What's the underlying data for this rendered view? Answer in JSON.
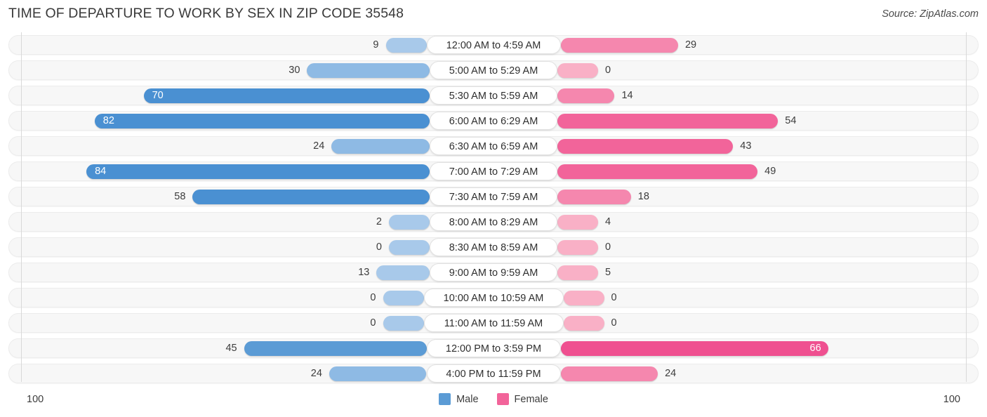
{
  "header": {
    "title": "TIME OF DEPARTURE TO WORK BY SEX IN ZIP CODE 35548",
    "source": "Source: ZipAtlas.com"
  },
  "legend": {
    "male_label": "Male",
    "female_label": "Female",
    "male_color": "#5b9bd5",
    "female_color": "#f2649a"
  },
  "axis": {
    "left_end": "100",
    "right_end": "100"
  },
  "chart_data": {
    "type": "bar",
    "orientation": "horizontal",
    "style": "diverging-bidirectional",
    "title": "TIME OF DEPARTURE TO WORK BY SEX IN ZIP CODE 35548",
    "xlabel": "",
    "ylabel": "",
    "xlim": [
      0,
      100
    ],
    "grid": false,
    "legend_position": "bottom-center",
    "categories": [
      "12:00 AM to 4:59 AM",
      "5:00 AM to 5:29 AM",
      "5:30 AM to 5:59 AM",
      "6:00 AM to 6:29 AM",
      "6:30 AM to 6:59 AM",
      "7:00 AM to 7:29 AM",
      "7:30 AM to 7:59 AM",
      "8:00 AM to 8:29 AM",
      "8:30 AM to 8:59 AM",
      "9:00 AM to 9:59 AM",
      "10:00 AM to 10:59 AM",
      "11:00 AM to 11:59 AM",
      "12:00 PM to 3:59 PM",
      "4:00 PM to 11:59 PM"
    ],
    "series": [
      {
        "name": "Male",
        "side": "left",
        "values": [
          9,
          30,
          70,
          82,
          24,
          84,
          58,
          2,
          0,
          13,
          0,
          0,
          45,
          24
        ]
      },
      {
        "name": "Female",
        "side": "right",
        "values": [
          29,
          0,
          14,
          54,
          43,
          49,
          18,
          4,
          0,
          5,
          0,
          0,
          66,
          24
        ]
      }
    ]
  },
  "rows": [
    {
      "category": "12:00 AM to 4:59 AM",
      "male": "9",
      "female": "29"
    },
    {
      "category": "5:00 AM to 5:29 AM",
      "male": "30",
      "female": "0"
    },
    {
      "category": "5:30 AM to 5:59 AM",
      "male": "70",
      "female": "14"
    },
    {
      "category": "6:00 AM to 6:29 AM",
      "male": "82",
      "female": "54"
    },
    {
      "category": "6:30 AM to 6:59 AM",
      "male": "24",
      "female": "43"
    },
    {
      "category": "7:00 AM to 7:29 AM",
      "male": "84",
      "female": "49"
    },
    {
      "category": "7:30 AM to 7:59 AM",
      "male": "58",
      "female": "18"
    },
    {
      "category": "8:00 AM to 8:29 AM",
      "male": "2",
      "female": "4"
    },
    {
      "category": "8:30 AM to 8:59 AM",
      "male": "0",
      "female": "0"
    },
    {
      "category": "9:00 AM to 9:59 AM",
      "male": "13",
      "female": "5"
    },
    {
      "category": "10:00 AM to 10:59 AM",
      "male": "0",
      "female": "0"
    },
    {
      "category": "11:00 AM to 11:59 AM",
      "male": "0",
      "female": "0"
    },
    {
      "category": "12:00 PM to 3:59 PM",
      "male": "45",
      "female": "66"
    },
    {
      "category": "4:00 PM to 11:59 PM",
      "male": "24",
      "female": "24"
    }
  ]
}
